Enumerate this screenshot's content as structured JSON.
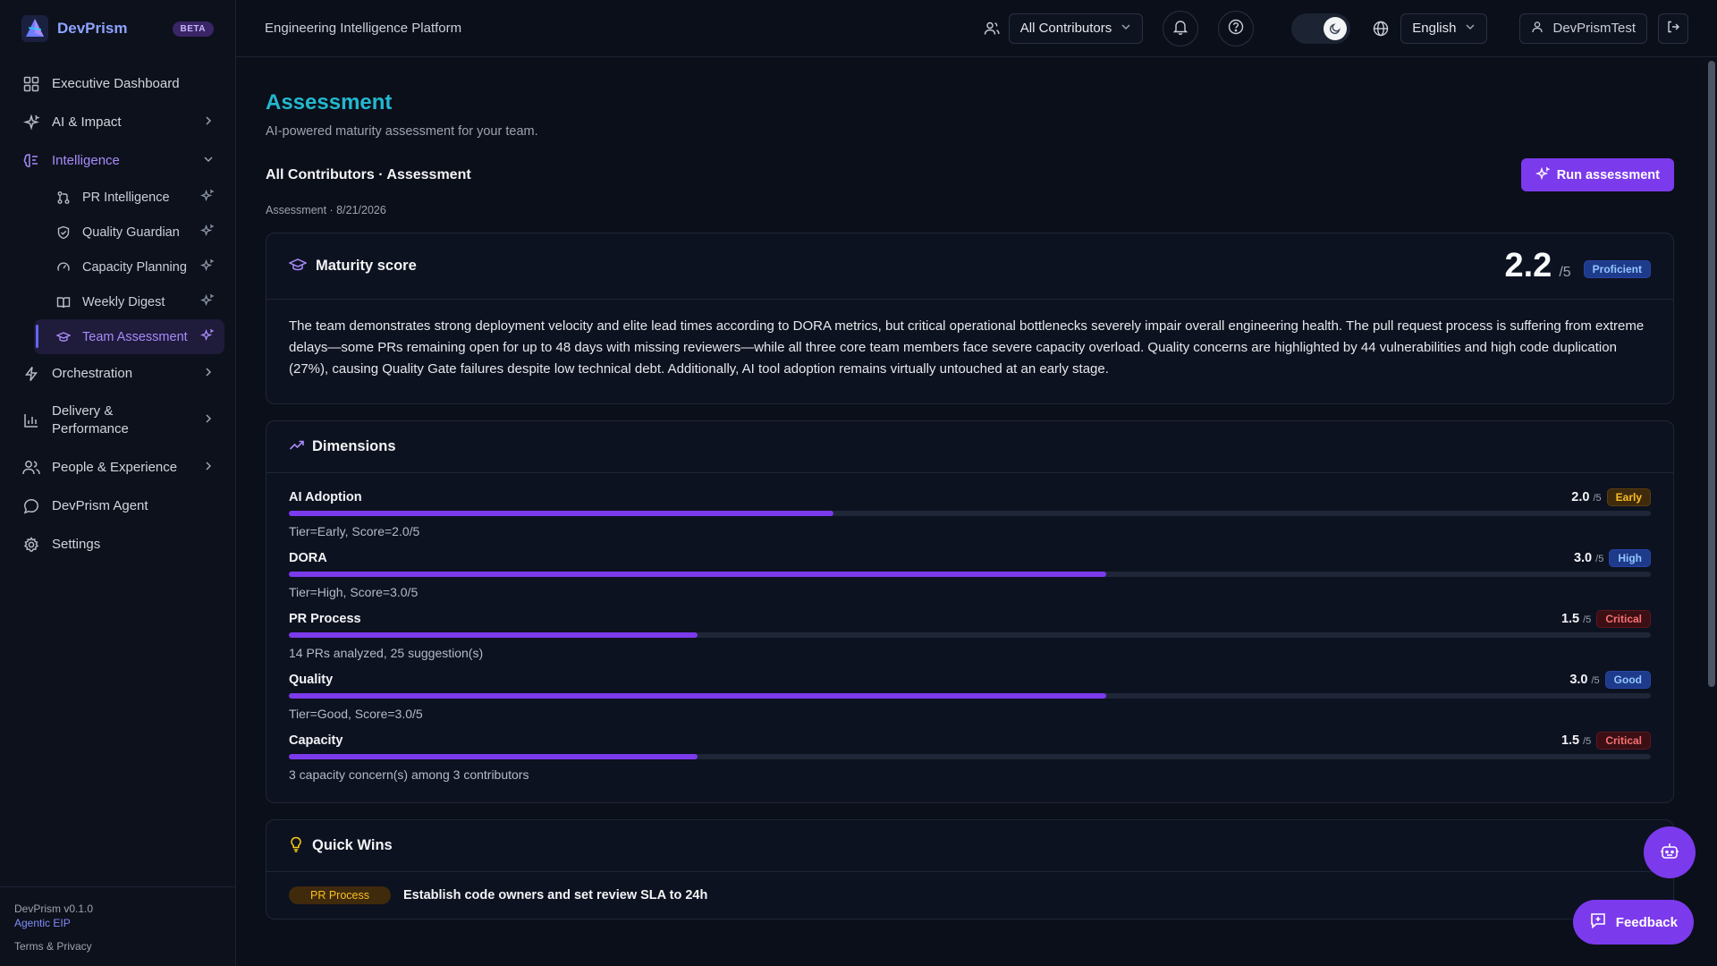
{
  "brand": {
    "name": "DevPrism",
    "badge": "BETA"
  },
  "sidebar": {
    "items": [
      {
        "label": "Executive Dashboard",
        "icon": "grid-icon"
      },
      {
        "label": "AI & Impact",
        "icon": "sparkles-icon"
      },
      {
        "label": "Intelligence",
        "icon": "brain-icon"
      },
      {
        "label": "Orchestration",
        "icon": "bolt-icon"
      },
      {
        "label": "Delivery &\nPerformance",
        "icon": "bar-chart-icon"
      },
      {
        "label": "People & Experience",
        "icon": "users-icon"
      },
      {
        "label": "DevPrism Agent",
        "icon": "chat-icon"
      },
      {
        "label": "Settings",
        "icon": "gear-icon"
      }
    ],
    "sub_items": [
      {
        "label": "PR Intelligence",
        "icon": "git-pull-request-icon"
      },
      {
        "label": "Quality Guardian",
        "icon": "shield-icon"
      },
      {
        "label": "Capacity Planning",
        "icon": "gauge-icon"
      },
      {
        "label": "Weekly Digest",
        "icon": "book-icon"
      },
      {
        "label": "Team Assessment",
        "icon": "graduation-cap-icon"
      }
    ],
    "footer": {
      "version": "DevPrism v0.1.0",
      "tagline": "Agentic EIP",
      "terms": "Terms & Privacy"
    }
  },
  "topbar": {
    "platform": "Engineering Intelligence Platform",
    "contributors": "All Contributors",
    "language": "English",
    "user": "DevPrismTest"
  },
  "page": {
    "title": "Assessment",
    "subtitle": "AI-powered maturity assessment for your team.",
    "context": "All Contributors · Assessment",
    "run_button": "Run assessment",
    "stamp": "Assessment · 8/21/2026"
  },
  "maturity": {
    "title": "Maturity score",
    "score": "2.2",
    "denominator": "/5",
    "tier": "Proficient",
    "summary": "The team demonstrates strong deployment velocity and elite lead times according to DORA metrics, but critical operational bottlenecks severely impair overall engineering health. The pull request process is suffering from extreme delays—some PRs remaining open for up to 48 days with missing reviewers—while all three core team members face severe capacity overload. Quality concerns are highlighted by 44 vulnerabilities and high code duplication (27%), causing Quality Gate failures despite low technical debt. Additionally, AI tool adoption remains virtually untouched at an early stage."
  },
  "dimensions": {
    "title": "Dimensions",
    "items": [
      {
        "name": "AI Adoption",
        "score": "2.0",
        "den": "/5",
        "tier": "Early",
        "tone": "amber",
        "fraction": 0.4,
        "note": "Tier=Early, Score=2.0/5"
      },
      {
        "name": "DORA",
        "score": "3.0",
        "den": "/5",
        "tier": "High",
        "tone": "blue",
        "fraction": 0.6,
        "note": "Tier=High, Score=3.0/5"
      },
      {
        "name": "PR Process",
        "score": "1.5",
        "den": "/5",
        "tier": "Critical",
        "tone": "red",
        "fraction": 0.3,
        "note": "14 PRs analyzed, 25 suggestion(s)"
      },
      {
        "name": "Quality",
        "score": "3.0",
        "den": "/5",
        "tier": "Good",
        "tone": "blue",
        "fraction": 0.6,
        "note": "Tier=Good, Score=3.0/5"
      },
      {
        "name": "Capacity",
        "score": "1.5",
        "den": "/5",
        "tier": "Critical",
        "tone": "red",
        "fraction": 0.3,
        "note": "3 capacity concern(s) among 3 contributors"
      }
    ]
  },
  "quick_wins": {
    "title": "Quick Wins",
    "items": [
      {
        "tag": "PR Process",
        "text": "Establish code owners and set review SLA to 24h"
      }
    ]
  },
  "feedback": {
    "label": "Feedback"
  },
  "colors": {
    "accent": "#7c3aed",
    "title": "#22b8cf"
  }
}
